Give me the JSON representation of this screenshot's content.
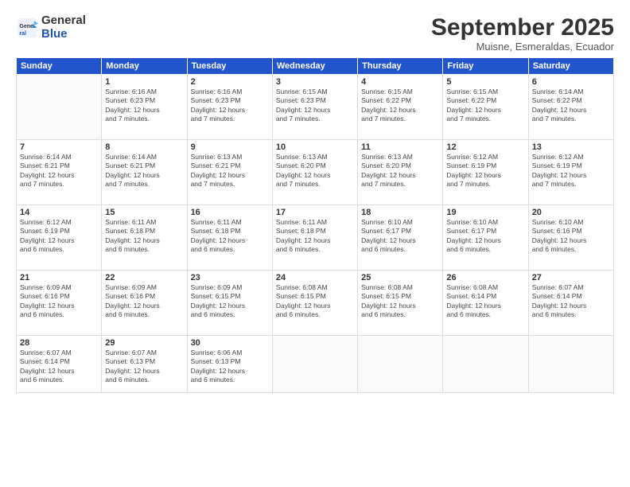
{
  "logo": {
    "general": "General",
    "blue": "Blue"
  },
  "title": "September 2025",
  "subtitle": "Muisne, Esmeraldas, Ecuador",
  "days_of_week": [
    "Sunday",
    "Monday",
    "Tuesday",
    "Wednesday",
    "Thursday",
    "Friday",
    "Saturday"
  ],
  "weeks": [
    [
      {
        "day": "",
        "info": ""
      },
      {
        "day": "1",
        "info": "Sunrise: 6:16 AM\nSunset: 6:23 PM\nDaylight: 12 hours\nand 7 minutes."
      },
      {
        "day": "2",
        "info": "Sunrise: 6:16 AM\nSunset: 6:23 PM\nDaylight: 12 hours\nand 7 minutes."
      },
      {
        "day": "3",
        "info": "Sunrise: 6:15 AM\nSunset: 6:23 PM\nDaylight: 12 hours\nand 7 minutes."
      },
      {
        "day": "4",
        "info": "Sunrise: 6:15 AM\nSunset: 6:22 PM\nDaylight: 12 hours\nand 7 minutes."
      },
      {
        "day": "5",
        "info": "Sunrise: 6:15 AM\nSunset: 6:22 PM\nDaylight: 12 hours\nand 7 minutes."
      },
      {
        "day": "6",
        "info": "Sunrise: 6:14 AM\nSunset: 6:22 PM\nDaylight: 12 hours\nand 7 minutes."
      }
    ],
    [
      {
        "day": "7",
        "info": "Sunrise: 6:14 AM\nSunset: 6:21 PM\nDaylight: 12 hours\nand 7 minutes."
      },
      {
        "day": "8",
        "info": "Sunrise: 6:14 AM\nSunset: 6:21 PM\nDaylight: 12 hours\nand 7 minutes."
      },
      {
        "day": "9",
        "info": "Sunrise: 6:13 AM\nSunset: 6:21 PM\nDaylight: 12 hours\nand 7 minutes."
      },
      {
        "day": "10",
        "info": "Sunrise: 6:13 AM\nSunset: 6:20 PM\nDaylight: 12 hours\nand 7 minutes."
      },
      {
        "day": "11",
        "info": "Sunrise: 6:13 AM\nSunset: 6:20 PM\nDaylight: 12 hours\nand 7 minutes."
      },
      {
        "day": "12",
        "info": "Sunrise: 6:12 AM\nSunset: 6:19 PM\nDaylight: 12 hours\nand 7 minutes."
      },
      {
        "day": "13",
        "info": "Sunrise: 6:12 AM\nSunset: 6:19 PM\nDaylight: 12 hours\nand 7 minutes."
      }
    ],
    [
      {
        "day": "14",
        "info": "Sunrise: 6:12 AM\nSunset: 6:19 PM\nDaylight: 12 hours\nand 6 minutes."
      },
      {
        "day": "15",
        "info": "Sunrise: 6:11 AM\nSunset: 6:18 PM\nDaylight: 12 hours\nand 6 minutes."
      },
      {
        "day": "16",
        "info": "Sunrise: 6:11 AM\nSunset: 6:18 PM\nDaylight: 12 hours\nand 6 minutes."
      },
      {
        "day": "17",
        "info": "Sunrise: 6:11 AM\nSunset: 6:18 PM\nDaylight: 12 hours\nand 6 minutes."
      },
      {
        "day": "18",
        "info": "Sunrise: 6:10 AM\nSunset: 6:17 PM\nDaylight: 12 hours\nand 6 minutes."
      },
      {
        "day": "19",
        "info": "Sunrise: 6:10 AM\nSunset: 6:17 PM\nDaylight: 12 hours\nand 6 minutes."
      },
      {
        "day": "20",
        "info": "Sunrise: 6:10 AM\nSunset: 6:16 PM\nDaylight: 12 hours\nand 6 minutes."
      }
    ],
    [
      {
        "day": "21",
        "info": "Sunrise: 6:09 AM\nSunset: 6:16 PM\nDaylight: 12 hours\nand 6 minutes."
      },
      {
        "day": "22",
        "info": "Sunrise: 6:09 AM\nSunset: 6:16 PM\nDaylight: 12 hours\nand 6 minutes."
      },
      {
        "day": "23",
        "info": "Sunrise: 6:09 AM\nSunset: 6:15 PM\nDaylight: 12 hours\nand 6 minutes."
      },
      {
        "day": "24",
        "info": "Sunrise: 6:08 AM\nSunset: 6:15 PM\nDaylight: 12 hours\nand 6 minutes."
      },
      {
        "day": "25",
        "info": "Sunrise: 6:08 AM\nSunset: 6:15 PM\nDaylight: 12 hours\nand 6 minutes."
      },
      {
        "day": "26",
        "info": "Sunrise: 6:08 AM\nSunset: 6:14 PM\nDaylight: 12 hours\nand 6 minutes."
      },
      {
        "day": "27",
        "info": "Sunrise: 6:07 AM\nSunset: 6:14 PM\nDaylight: 12 hours\nand 6 minutes."
      }
    ],
    [
      {
        "day": "28",
        "info": "Sunrise: 6:07 AM\nSunset: 6:14 PM\nDaylight: 12 hours\nand 6 minutes."
      },
      {
        "day": "29",
        "info": "Sunrise: 6:07 AM\nSunset: 6:13 PM\nDaylight: 12 hours\nand 6 minutes."
      },
      {
        "day": "30",
        "info": "Sunrise: 6:06 AM\nSunset: 6:13 PM\nDaylight: 12 hours\nand 6 minutes."
      },
      {
        "day": "",
        "info": ""
      },
      {
        "day": "",
        "info": ""
      },
      {
        "day": "",
        "info": ""
      },
      {
        "day": "",
        "info": ""
      }
    ]
  ]
}
